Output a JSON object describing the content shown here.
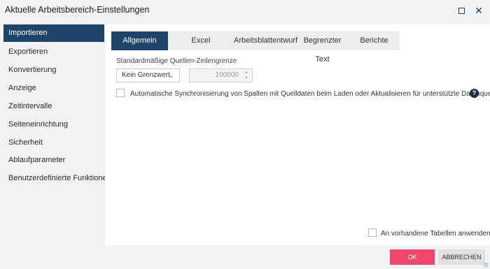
{
  "window": {
    "title": "Aktuelle Arbeitsbereich-Einstellungen",
    "icons": {
      "maximize": "maximize-icon",
      "close": "close-icon"
    }
  },
  "sidebar": {
    "items": [
      {
        "label": "Importieren",
        "active": true
      },
      {
        "label": "Exportieren",
        "active": false
      },
      {
        "label": "Konvertierung",
        "active": false
      },
      {
        "label": "Anzeige",
        "active": false
      },
      {
        "label": "Zeitintervalle",
        "active": false
      },
      {
        "label": "Seiteneinrichtung",
        "active": false
      },
      {
        "label": "Sicherheit",
        "active": false
      },
      {
        "label": "Ablaufparameter",
        "active": false
      },
      {
        "label": "Benutzerdefinierte Funktionen",
        "active": false
      }
    ]
  },
  "tabs": [
    {
      "label": "Allgemein",
      "active": true
    },
    {
      "label": "Excel",
      "active": false
    },
    {
      "label": "Arbeitsblattentwurf",
      "active": false
    },
    {
      "label": "Begrenzter Text",
      "active": false
    },
    {
      "label": "Berichte",
      "active": false
    }
  ],
  "general": {
    "row_limit_label": "Standardmäßige Quellen-Zeilengrenze",
    "limit_select_value": "Kein Grenzwert",
    "limit_number_value": "100000",
    "sync_checkbox_label": "Automatische Synchronisierung von Spalten mit Quelldaten beim Laden oder Aktualisieren für unterstützte Datenquellen.",
    "sync_checked": false,
    "help_icon": "help-icon",
    "help_glyph": "?",
    "apply_checkbox_label": "An vorhandene Tabellen anwenden",
    "apply_checked": false
  },
  "footer": {
    "ok_label": "OK",
    "cancel_label": "ABBRECHEN"
  },
  "colors": {
    "accent": "#1f4469",
    "primary_button": "#f0476c",
    "background": "#f1f2f3"
  }
}
